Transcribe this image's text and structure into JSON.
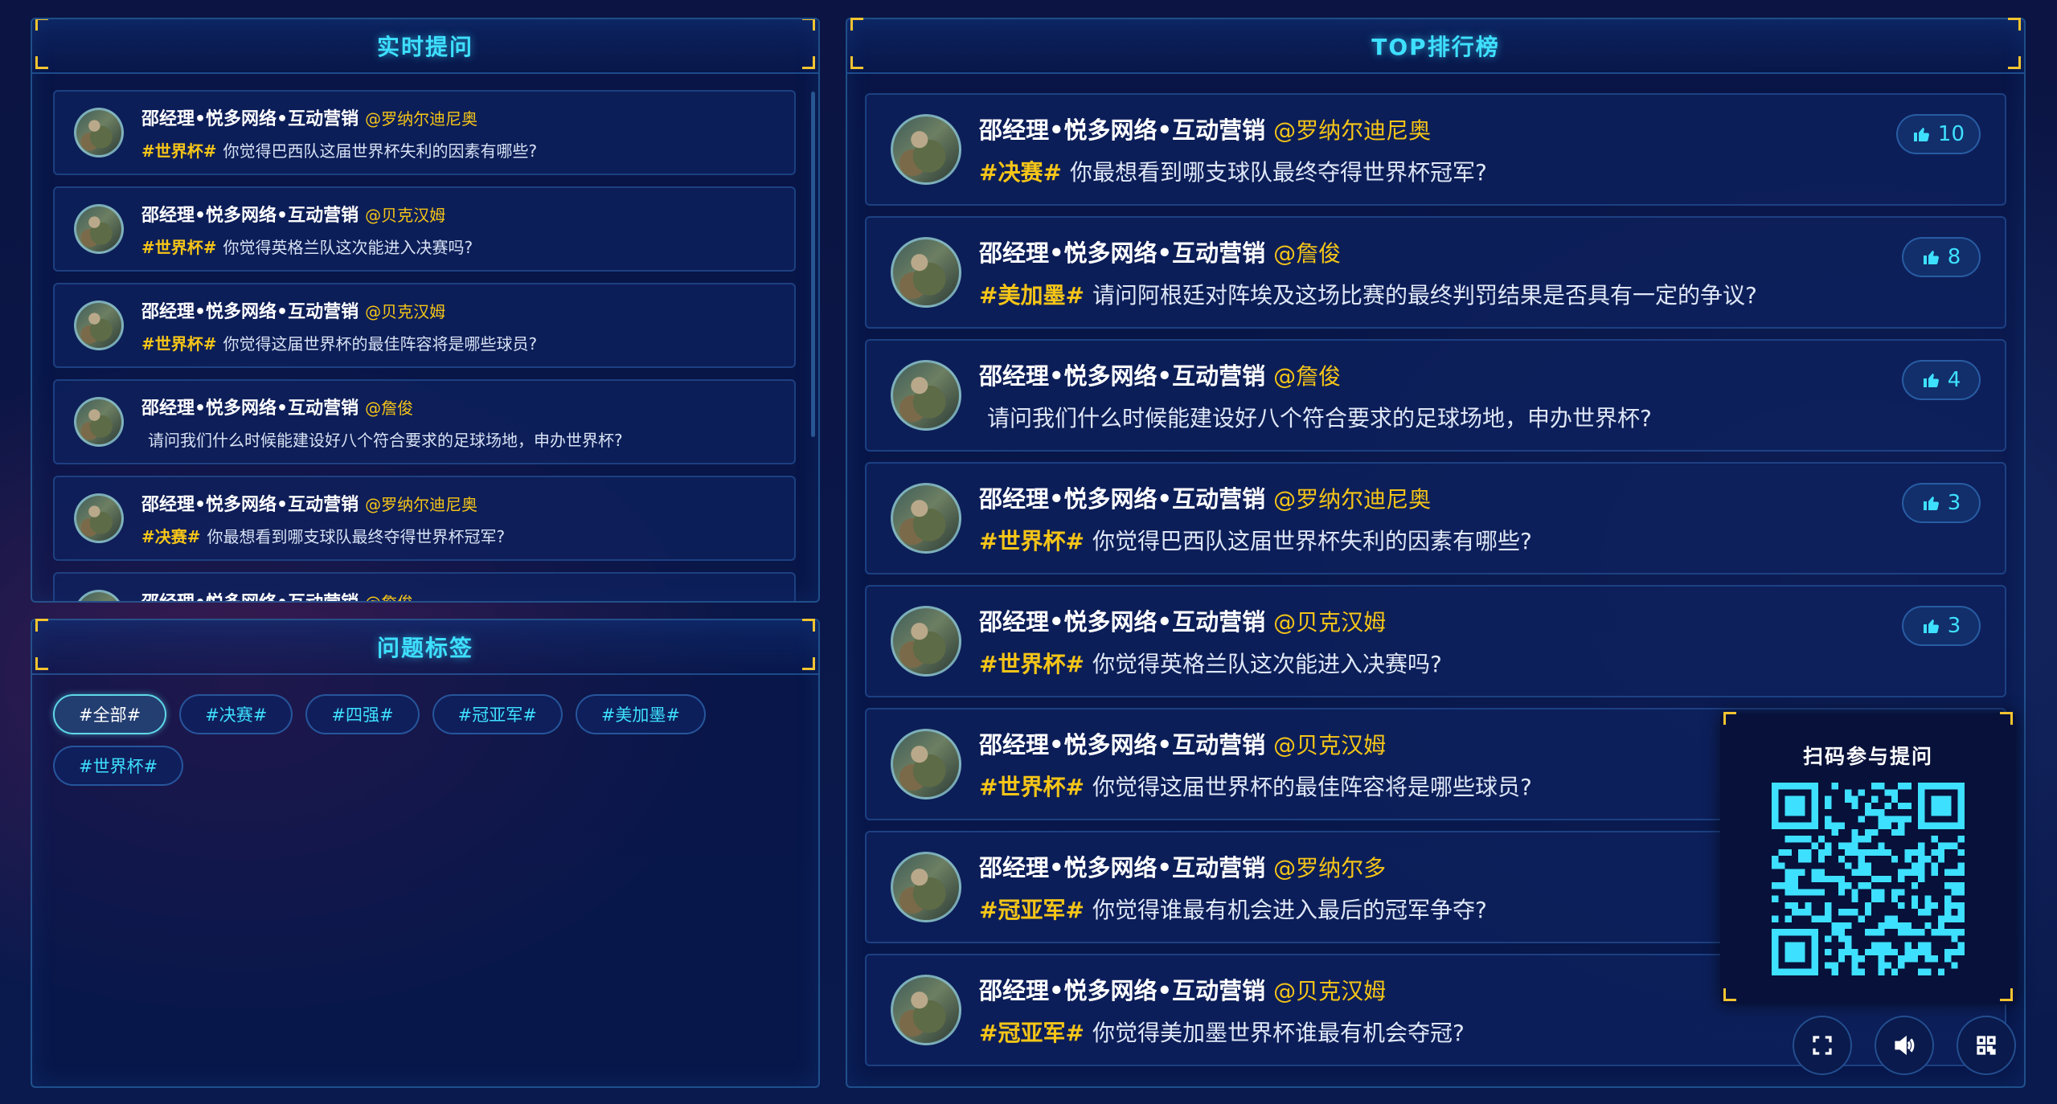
{
  "live": {
    "title": "实时提问",
    "items": [
      {
        "name": "邵经理•悦多网络•互动营销",
        "at": "@罗纳尔迪尼奥",
        "tag": "#世界杯#",
        "text": "你觉得巴西队这届世界杯失利的因素有哪些?"
      },
      {
        "name": "邵经理•悦多网络•互动营销",
        "at": "@贝克汉姆",
        "tag": "#世界杯#",
        "text": "你觉得英格兰队这次能进入决赛吗?"
      },
      {
        "name": "邵经理•悦多网络•互动营销",
        "at": "@贝克汉姆",
        "tag": "#世界杯#",
        "text": "你觉得这届世界杯的最佳阵容将是哪些球员?"
      },
      {
        "name": "邵经理•悦多网络•互动营销",
        "at": "@詹俊",
        "tag": "",
        "text": "请问我们什么时候能建设好八个符合要求的足球场地，申办世界杯?"
      },
      {
        "name": "邵经理•悦多网络•互动营销",
        "at": "@罗纳尔迪尼奥",
        "tag": "#决赛#",
        "text": "你最想看到哪支球队最终夺得世界杯冠军?"
      },
      {
        "name": "邵经理•悦多网络•互动营销",
        "at": "@詹俊",
        "tag": "",
        "text": ""
      }
    ]
  },
  "tags": {
    "title": "问题标签",
    "items": [
      "#全部#",
      "#决赛#",
      "#四强#",
      "#冠亚军#",
      "#美加墨#",
      "#世界杯#"
    ],
    "active_index": 0
  },
  "top": {
    "title": "TOP排行榜",
    "items": [
      {
        "name": "邵经理•悦多网络•互动营销",
        "at": "@罗纳尔迪尼奥",
        "tag": "#决赛#",
        "text": "你最想看到哪支球队最终夺得世界杯冠军?",
        "likes": "10"
      },
      {
        "name": "邵经理•悦多网络•互动营销",
        "at": "@詹俊",
        "tag": "#美加墨#",
        "text": "请问阿根廷对阵埃及这场比赛的最终判罚结果是否具有一定的争议?",
        "likes": "8"
      },
      {
        "name": "邵经理•悦多网络•互动营销",
        "at": "@詹俊",
        "tag": "",
        "text": "请问我们什么时候能建设好八个符合要求的足球场地，申办世界杯?",
        "likes": "4"
      },
      {
        "name": "邵经理•悦多网络•互动营销",
        "at": "@罗纳尔迪尼奥",
        "tag": "#世界杯#",
        "text": "你觉得巴西队这届世界杯失利的因素有哪些?",
        "likes": "3"
      },
      {
        "name": "邵经理•悦多网络•互动营销",
        "at": "@贝克汉姆",
        "tag": "#世界杯#",
        "text": "你觉得英格兰队这次能进入决赛吗?",
        "likes": "3"
      },
      {
        "name": "邵经理•悦多网络•互动营销",
        "at": "@贝克汉姆",
        "tag": "#世界杯#",
        "text": "你觉得这届世界杯的最佳阵容将是哪些球员?",
        "likes": ""
      },
      {
        "name": "邵经理•悦多网络•互动营销",
        "at": "@罗纳尔多",
        "tag": "#冠亚军#",
        "text": "你觉得谁最有机会进入最后的冠军争夺?",
        "likes": ""
      },
      {
        "name": "邵经理•悦多网络•互动营销",
        "at": "@贝克汉姆",
        "tag": "#冠亚军#",
        "text": "你觉得美加墨世界杯谁最有机会夺冠?",
        "likes": ""
      }
    ]
  },
  "qr": {
    "title": "扫码参与提问"
  },
  "controls": [
    {
      "icon": "fullscreen-icon"
    },
    {
      "icon": "volume-icon"
    },
    {
      "icon": "qrcode-icon"
    }
  ],
  "colors": {
    "accent": "#3ee0ff",
    "highlight": "#f5c518",
    "frame_corner": "#f4c430",
    "background": "#0a1440"
  }
}
